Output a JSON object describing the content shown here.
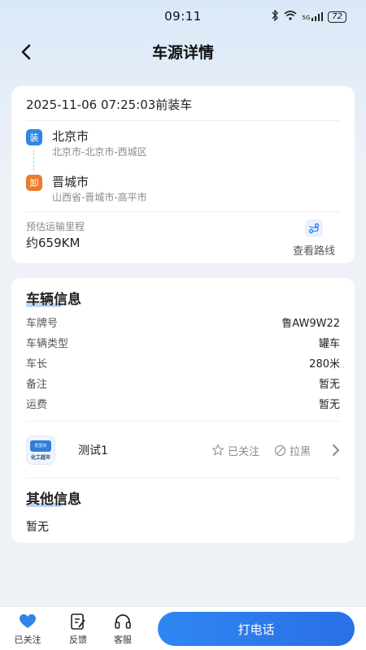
{
  "status_bar": {
    "time": "09:11",
    "signal_label": "5G",
    "battery": "72"
  },
  "header": {
    "title": "车源详情"
  },
  "route_card": {
    "load_time": "2025-11-06 07:25:03前装车",
    "origin": {
      "tag": "装",
      "city": "北京市",
      "address": "北京市-北京市-西城区"
    },
    "destination": {
      "tag": "卸",
      "city": "晋城市",
      "address": "山西省-晋城市-高平市"
    },
    "distance_label": "预估运输里程",
    "distance_value": "约659KM",
    "route_link": "查看路线"
  },
  "vehicle_card": {
    "title": "车辆信息",
    "rows": [
      {
        "key": "车牌号",
        "value": "鲁AW9W22"
      },
      {
        "key": "车辆类型",
        "value": "罐车"
      },
      {
        "key": "车长",
        "value": "280米"
      },
      {
        "key": "备注",
        "value": "暂无"
      },
      {
        "key": "运费",
        "value": "暂无"
      }
    ],
    "shipper": {
      "avatar_top_text": "危爱好",
      "avatar_bottom_text": "化工超市",
      "name": "测试1",
      "follow_label": "已关注",
      "block_label": "拉黑"
    },
    "other_title": "其他信息",
    "other_text": "暂无"
  },
  "bottom_bar": {
    "tabs": [
      {
        "label": "已关注"
      },
      {
        "label": "反馈"
      },
      {
        "label": "客服"
      }
    ],
    "call_button": "打电话"
  },
  "colors": {
    "accent": "#2d86e8",
    "load_tag": "#2d86e8",
    "unload_tag": "#ee7a2c"
  }
}
